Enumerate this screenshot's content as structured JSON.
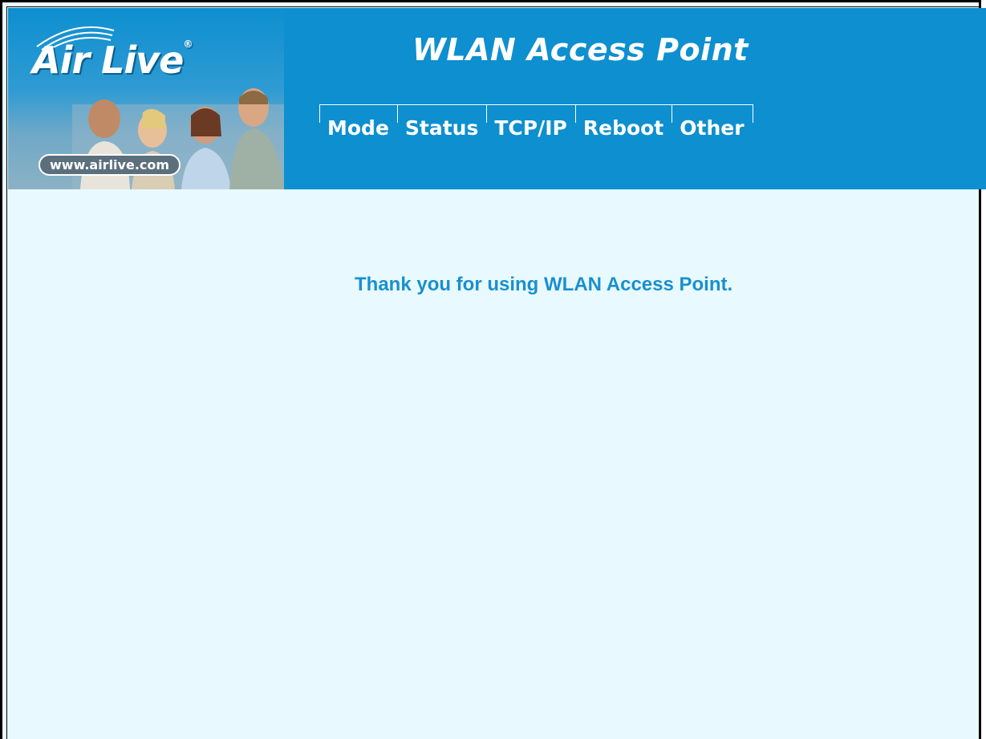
{
  "header": {
    "brand": "Air Live",
    "brand_mark": "®",
    "url": "www.airlive.com",
    "title": "WLAN Access Point",
    "colors": {
      "banner": "#0d8fd0",
      "text": "#ffffff"
    }
  },
  "nav": {
    "items": [
      {
        "label": "Mode"
      },
      {
        "label": "Status"
      },
      {
        "label": "TCP/IP"
      },
      {
        "label": "Reboot"
      },
      {
        "label": "Other"
      }
    ]
  },
  "main": {
    "message": "Thank you for using WLAN Access Point.",
    "colors": {
      "background": "#e8faff",
      "message": "#1a8fcf"
    }
  }
}
